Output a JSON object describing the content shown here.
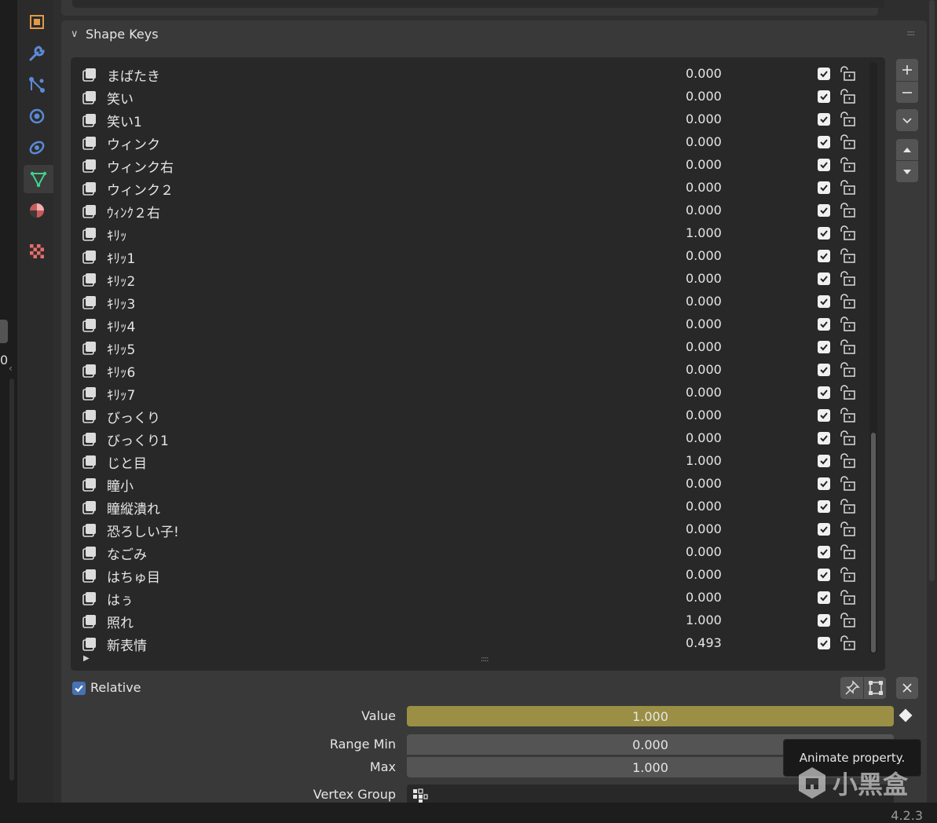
{
  "panel": {
    "title": "Shape Keys",
    "collapse_icon": "chevron-down-icon",
    "grip_icon": "drag-grip-icon"
  },
  "shape_keys": [
    {
      "name": "まばたき",
      "value": "0.000",
      "enabled": true
    },
    {
      "name": "笑い",
      "value": "0.000",
      "enabled": true
    },
    {
      "name": "笑い1",
      "value": "0.000",
      "enabled": true
    },
    {
      "name": "ウィンク",
      "value": "0.000",
      "enabled": true
    },
    {
      "name": "ウィンク右",
      "value": "0.000",
      "enabled": true
    },
    {
      "name": "ウィンク２",
      "value": "0.000",
      "enabled": true
    },
    {
      "name": "ｳｨﾝｸ２右",
      "value": "0.000",
      "enabled": true
    },
    {
      "name": "ｷﾘｯ",
      "value": "1.000",
      "enabled": true
    },
    {
      "name": "ｷﾘｯ1",
      "value": "0.000",
      "enabled": true
    },
    {
      "name": "ｷﾘｯ2",
      "value": "0.000",
      "enabled": true
    },
    {
      "name": "ｷﾘｯ3",
      "value": "0.000",
      "enabled": true
    },
    {
      "name": "ｷﾘｯ4",
      "value": "0.000",
      "enabled": true
    },
    {
      "name": "ｷﾘｯ5",
      "value": "0.000",
      "enabled": true
    },
    {
      "name": "ｷﾘｯ6",
      "value": "0.000",
      "enabled": true
    },
    {
      "name": "ｷﾘｯ7",
      "value": "0.000",
      "enabled": true
    },
    {
      "name": "びっくり",
      "value": "0.000",
      "enabled": true
    },
    {
      "name": "びっくり1",
      "value": "0.000",
      "enabled": true
    },
    {
      "name": "じと目",
      "value": "1.000",
      "enabled": true
    },
    {
      "name": "瞳小",
      "value": "0.000",
      "enabled": true
    },
    {
      "name": "瞳縦潰れ",
      "value": "0.000",
      "enabled": true
    },
    {
      "name": "恐ろしい子!",
      "value": "0.000",
      "enabled": true
    },
    {
      "name": "なごみ",
      "value": "0.000",
      "enabled": true
    },
    {
      "name": "はちゅ目",
      "value": "0.000",
      "enabled": true
    },
    {
      "name": "はぅ",
      "value": "0.000",
      "enabled": true
    },
    {
      "name": "照れ",
      "value": "1.000",
      "enabled": true
    },
    {
      "name": "新表情",
      "value": "0.493",
      "enabled": true
    }
  ],
  "side_buttons": {
    "add": "plus-icon",
    "remove": "minus-icon",
    "specials": "chevron-down-icon",
    "move_up": "triangle-up-icon",
    "move_down": "triangle-down-icon"
  },
  "relative": {
    "label": "Relative",
    "checked": true
  },
  "properties": {
    "value_label": "Value",
    "value": "1.000",
    "range_min_label": "Range Min",
    "range_min": "0.000",
    "max_label": "Max",
    "max": "1.000",
    "vertex_group_label": "Vertex Group"
  },
  "tooltip": "Animate property.",
  "watermark": "小黑盒",
  "left_edge_value": "0",
  "version": "4.2.3",
  "colors": {
    "accent": "#4772b3",
    "value_bar": "#9a8f44",
    "active_tab_icon": "#3fd18e"
  },
  "tabs": [
    {
      "icon": "object-icon",
      "color": "#e09a4a"
    },
    {
      "icon": "wrench-modifier-icon",
      "color": "#5b8ad6"
    },
    {
      "icon": "particles-icon",
      "color": "#5b8ad6"
    },
    {
      "icon": "physics-icon",
      "color": "#5b8ad6"
    },
    {
      "icon": "constraints-icon",
      "color": "#5b8ad6"
    },
    {
      "icon": "mesh-data-icon",
      "color": "#3fd18e"
    },
    {
      "icon": "material-icon",
      "color": "#e07070"
    },
    {
      "icon": "texture-icon",
      "color": "#e07070"
    }
  ]
}
